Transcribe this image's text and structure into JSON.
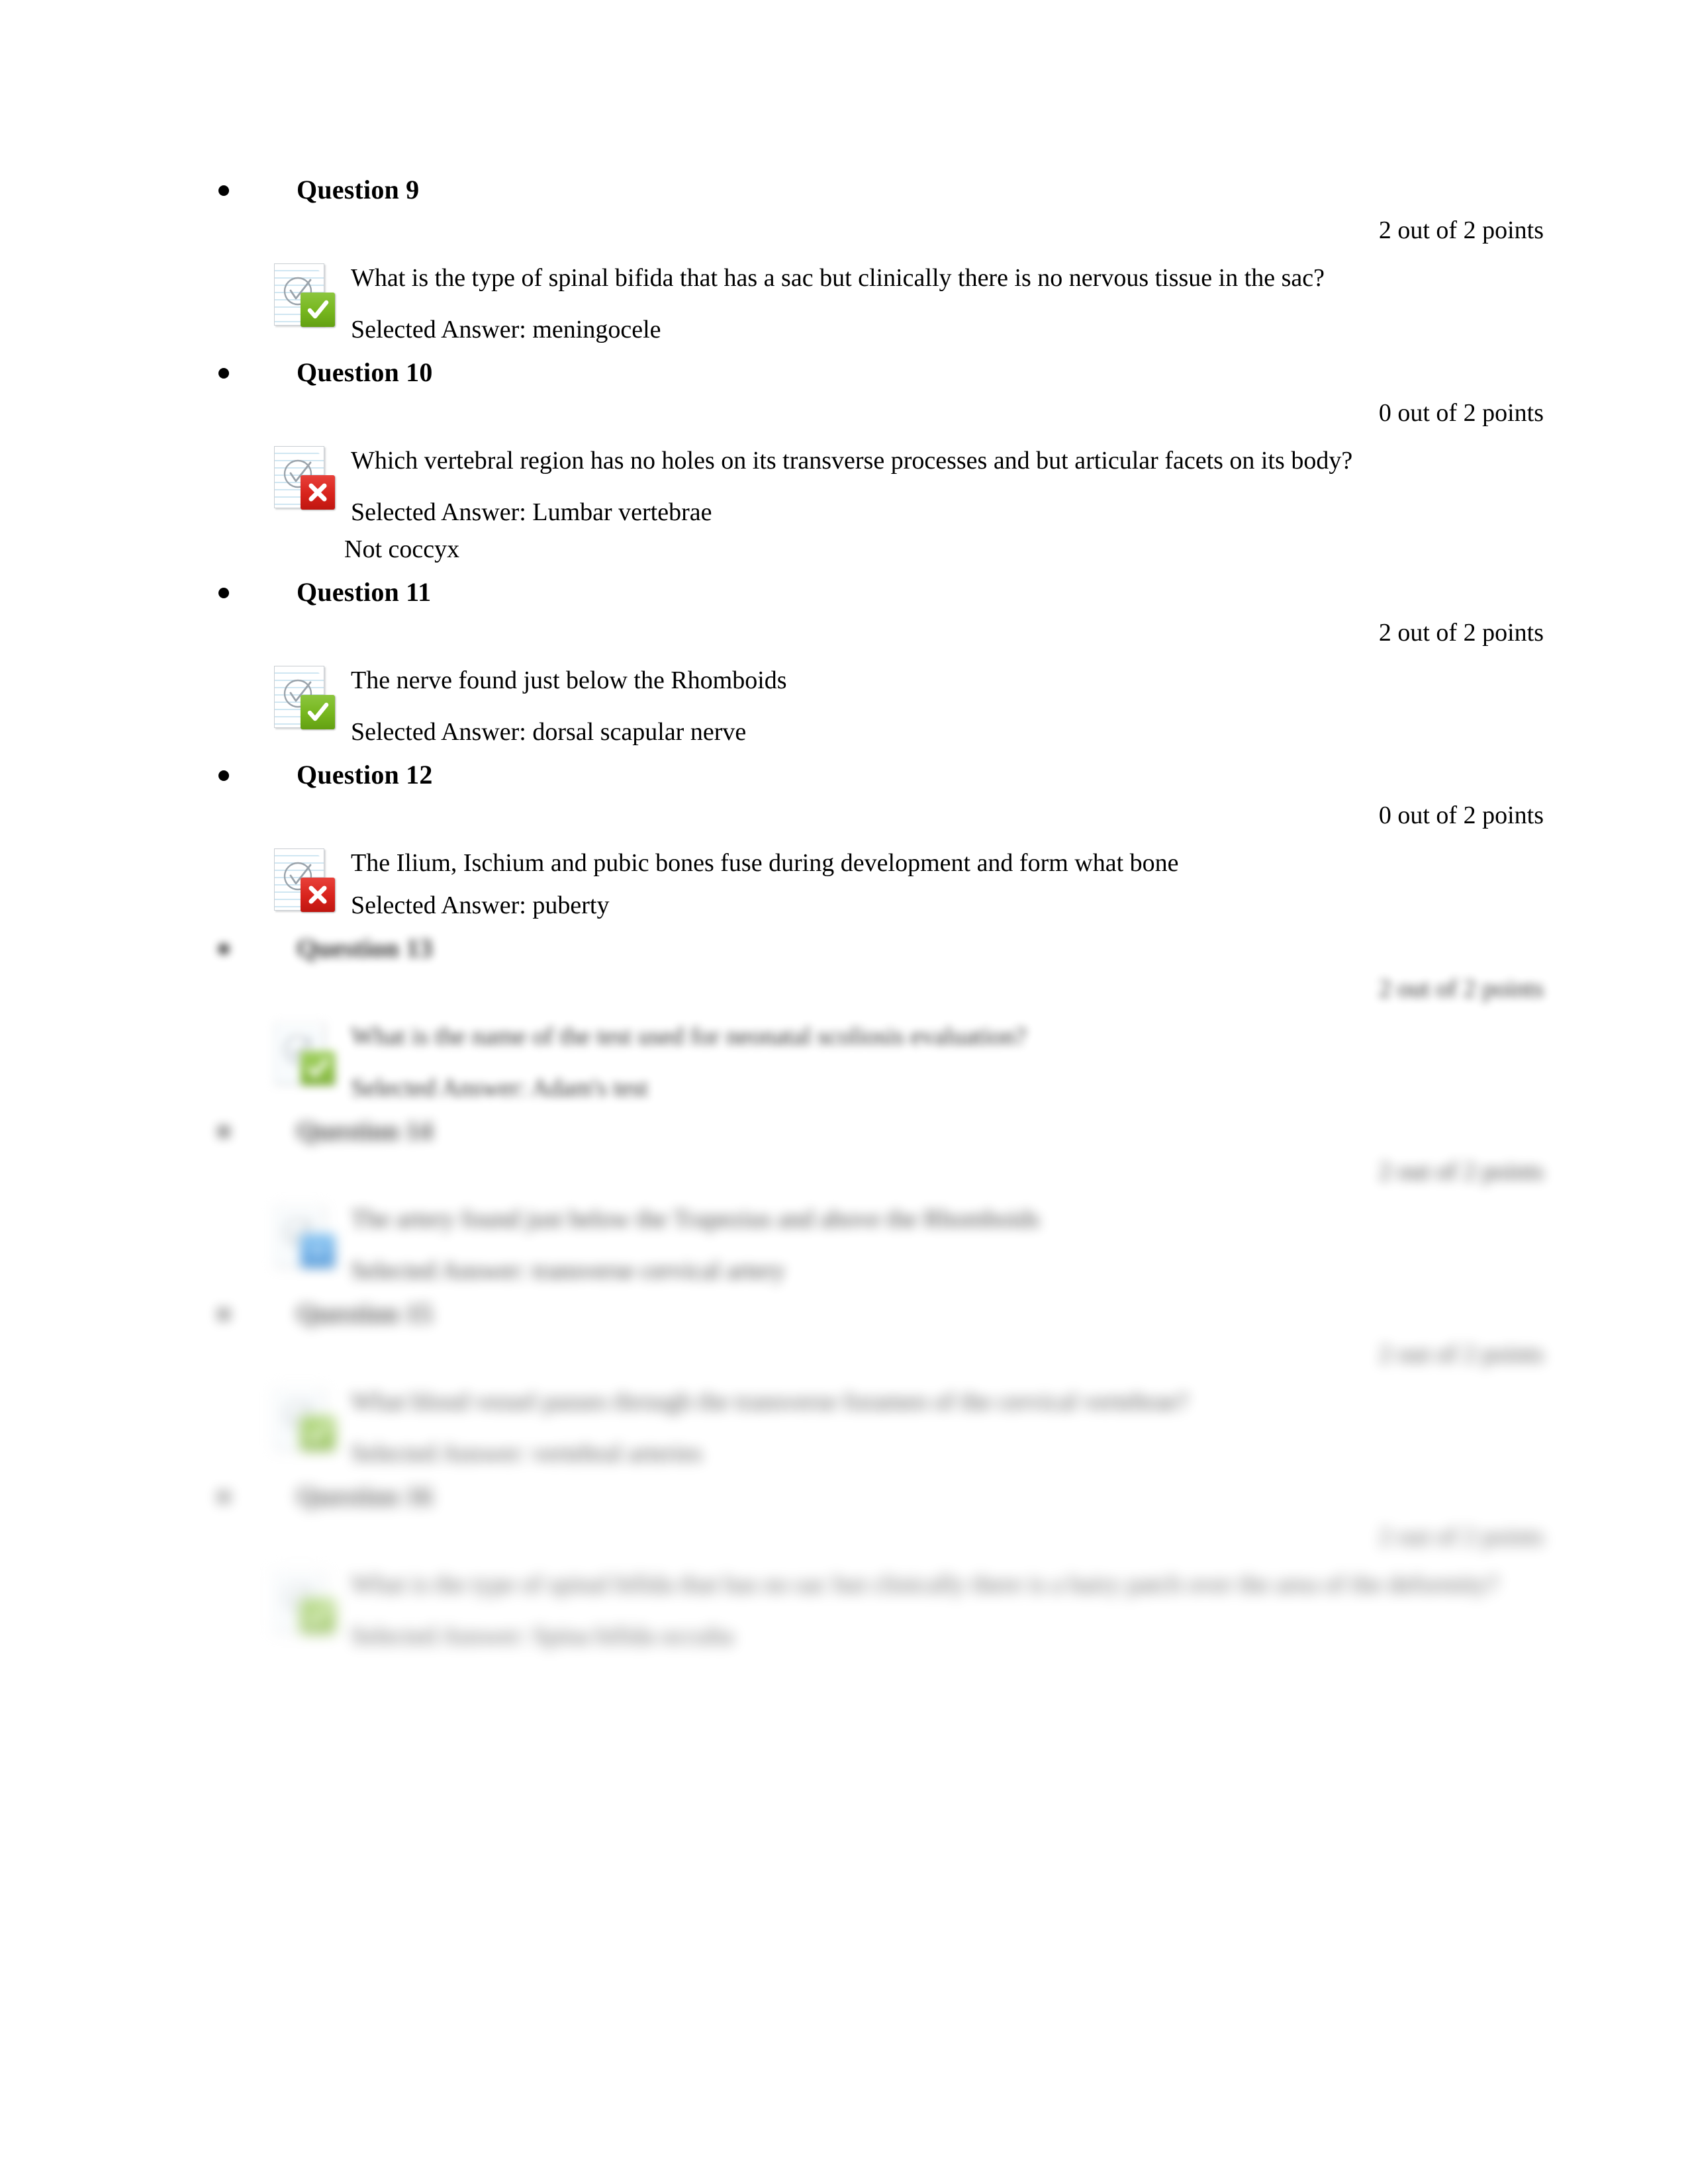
{
  "document": {
    "type": "exam-review",
    "page_background": "#ffffff",
    "text_color": "#000000"
  },
  "status_colors": {
    "correct": "#76b61e",
    "incorrect": "#d8231c",
    "partial": "#3a93e0"
  },
  "labels": {
    "selected_answer_prefix": "Selected Answer:"
  },
  "questions": [
    {
      "title": "Question 9",
      "points": "2 out of 2 points",
      "status": "correct",
      "icon": "document-check-icon",
      "badge_icon": "check-badge-icon",
      "text": "What is the type of spinal bifida that has a sac but clinically there is no nervous tissue in the sac?",
      "selected_answer": "Selected Answer: meningocele",
      "note": "",
      "blur": "sharp"
    },
    {
      "title": "Question 10",
      "points": "0 out of 2 points",
      "status": "incorrect",
      "icon": "document-check-icon",
      "badge_icon": "x-badge-icon",
      "text": "Which vertebral region has no holes on its transverse processes and but articular facets on its body?",
      "selected_answer": "Selected Answer: Lumbar vertebrae",
      "note": "Not coccyx",
      "blur": "sharp"
    },
    {
      "title": "Question 11",
      "points": "2 out of 2 points",
      "status": "correct",
      "icon": "document-check-icon",
      "badge_icon": "check-badge-icon",
      "text": "The nerve found just below the Rhomboids",
      "selected_answer": "Selected Answer: dorsal scapular nerve",
      "note": "",
      "blur": "sharp"
    },
    {
      "title": "Question 12",
      "points": "0 out of 2 points",
      "status": "incorrect",
      "icon": "document-check-icon",
      "badge_icon": "x-badge-icon",
      "text": "The Ilium, Ischium and pubic bones fuse during development and form what bone",
      "selected_answer": "Selected Answer: puberty",
      "note": "",
      "blur": "sharp"
    },
    {
      "title": "Question 13",
      "points": "2 out of 2 points",
      "status": "correct",
      "icon": "document-check-icon",
      "badge_icon": "check-badge-icon",
      "text": "What is the name of the test used for neonatal scoliosis evaluation?",
      "selected_answer": "Selected Answer: Adam's test",
      "note": "",
      "blur": "blur-b2"
    },
    {
      "title": "Question 14",
      "points": "2 out of 2 points",
      "status": "partial",
      "icon": "document-check-icon",
      "badge_icon": "partial-badge-icon",
      "text": "The artery found just below the Trapezius and above the Rhomboids",
      "selected_answer": "Selected Answer: transverse cervical artery",
      "note": "",
      "blur": "blur-b3"
    },
    {
      "title": "Question 15",
      "points": "2 out of 2 points",
      "status": "correct",
      "icon": "document-check-icon",
      "badge_icon": "check-badge-icon",
      "text": "What blood vessel passes through the transverse foramen of the cervical vertebrae?",
      "selected_answer": "Selected Answer: vertebral arteries",
      "note": "",
      "blur": "blur-b4"
    },
    {
      "title": "Question 16",
      "points": "2 out of 2 points",
      "status": "correct",
      "icon": "document-check-icon",
      "badge_icon": "check-badge-icon",
      "text": "What is the type of spinal bifida that has no sac but clinically there is a hairy patch over the area of the deformity?",
      "selected_answer": "Selected Answer: Spina bifida occulta",
      "note": "",
      "blur": "blur-b5"
    }
  ]
}
